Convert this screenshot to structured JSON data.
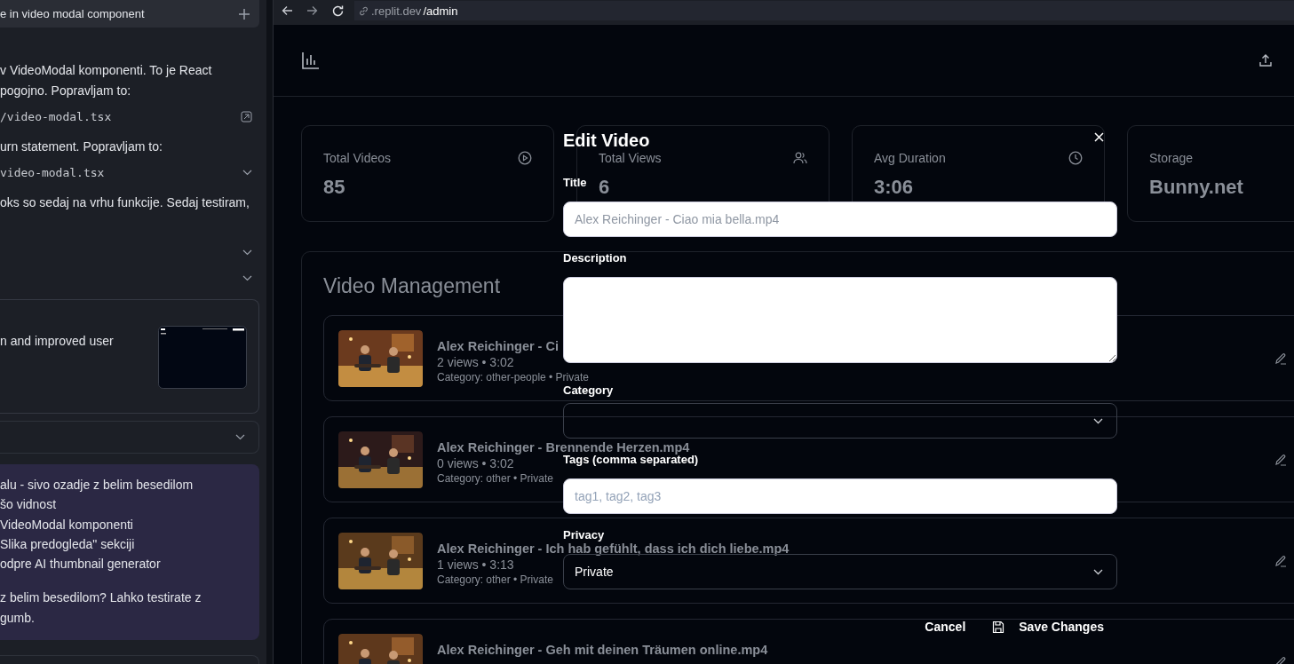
{
  "chat": {
    "tab_title": "e in video modal component",
    "items": [
      {
        "kind": "text",
        "lines": [
          "v VideoModal komponenti. To je React",
          "pogojno. Popravljam to:"
        ]
      },
      {
        "kind": "file-link",
        "path": "/video-modal.tsx"
      },
      {
        "kind": "text",
        "lines": [
          "urn statement. Popravljam to:"
        ]
      },
      {
        "kind": "file-collapsible",
        "path": "video-modal.tsx"
      },
      {
        "kind": "text",
        "lines": [
          "oks so sedaj na vrhu funkcije. Sedaj testiram,"
        ]
      },
      {
        "kind": "collapsed"
      },
      {
        "kind": "collapsed"
      },
      {
        "kind": "preview-card",
        "lines": [
          "n and improved user"
        ]
      },
      {
        "kind": "collapsed-box"
      },
      {
        "kind": "message",
        "paragraphs": [
          [
            "alu - sivo ozadje z belim besedilom",
            "šo vidnost",
            "VideoModal komponenti",
            "Slika predogleda\" sekciji",
            "odpre AI thumbnail generator"
          ],
          [
            "z belim besedilom? Lahko testirate z",
            "gumb."
          ]
        ]
      },
      {
        "kind": "panel-edge"
      }
    ]
  },
  "browser": {
    "url_host": ".replit.dev",
    "url_path": "/admin"
  },
  "stats": [
    {
      "label": "Total Videos",
      "value": "85"
    },
    {
      "label": "Total Views",
      "value": "6"
    },
    {
      "label": "Avg Duration",
      "value": "3:06"
    },
    {
      "label": "Storage",
      "value": "Bunny.net"
    }
  ],
  "videos": {
    "title": "Video Management",
    "rows": [
      {
        "title": "Alex Reichinger - Ci",
        "meta": "2 views • 3:02",
        "category": "Category: other-people • Private"
      },
      {
        "title": "Alex Reichinger - Brennende Herzen.mp4",
        "meta": "0 views • 3:02",
        "category": "Category: other • Private"
      },
      {
        "title": "Alex Reichinger - Ich hab gefühlt, dass ich dich liebe.mp4",
        "meta": "1 views • 3:13",
        "category": "Category: other • Private"
      },
      {
        "title": "Alex Reichinger - Geh mit deinen Träumen online.mp4"
      }
    ]
  },
  "modal": {
    "title": "Edit Video",
    "fields": [
      {
        "kind": "input",
        "label": "Title",
        "value": "Alex Reichinger - Ciao mia bella.mp4"
      },
      {
        "kind": "textarea",
        "label": "Description"
      },
      {
        "kind": "select",
        "label": "Category"
      },
      {
        "kind": "input",
        "label": "Tags (comma separated)",
        "placeholder": "tag1, tag2, tag3"
      },
      {
        "kind": "select",
        "label": "Privacy",
        "value": "Private"
      }
    ],
    "cancel": "Cancel",
    "save": "Save Changes"
  }
}
